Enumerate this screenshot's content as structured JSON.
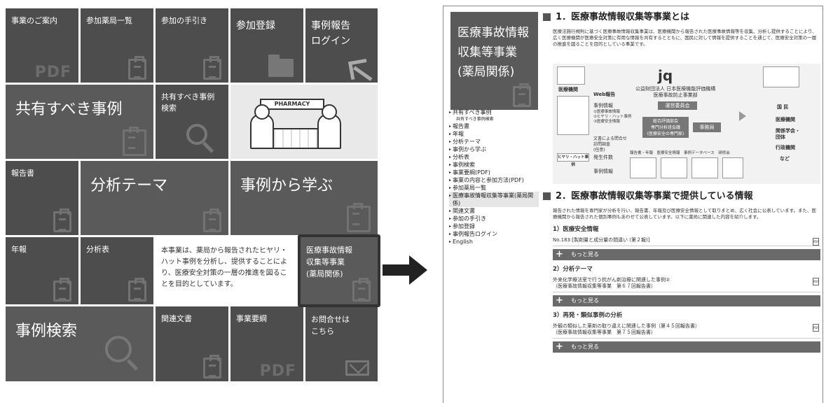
{
  "tiles": {
    "business_info": "事業のご案内",
    "pharmacies": "参加薬局一覧",
    "guide": "参加の手引き",
    "register": "参加登録",
    "report_login": "事例報告\nログイン",
    "shared_cases": "共有すべき事例",
    "shared_search": "共有すべき事例\n検索",
    "pharmacy_sign": "PHARMACY",
    "reports": "報告書",
    "analysis_themes": "分析テーマ",
    "learn_from_cases": "事例から学ぶ",
    "annual": "年報",
    "analysis_table": "分析表",
    "description": "本事業は、薬局から報告されたヒヤリ・ハット事例を分析し、提供することにより、医療安全対策の一層の推進を図ることを目的としています。",
    "project_tile": "医療事故情報\n収集等事業\n(薬局関係)",
    "case_search": "事例検索",
    "related_docs": "関連文書",
    "outline": "事業要綱",
    "contact": "お問合せは\nこちら",
    "pdf_mark": "PDF"
  },
  "page": {
    "tile_title": "医療事故情報\n収集等事業\n(薬局関係)",
    "sidebar": [
      {
        "label": "共有すべき事例",
        "sub": "共有すべき事例検索"
      },
      {
        "label": "報告書"
      },
      {
        "label": "年報"
      },
      {
        "label": "分析テーマ"
      },
      {
        "label": "事例から学ぶ"
      },
      {
        "label": "分析表"
      },
      {
        "label": "事例検索"
      },
      {
        "label": "事業要綱(PDF)"
      },
      {
        "label": "事業の内容と参加方法(PDF)"
      },
      {
        "label": "参加薬局一覧"
      },
      {
        "label": "医療事故情報収集等事業(薬局関係)",
        "active": true
      },
      {
        "label": "関連文書"
      },
      {
        "label": "参加の手引き"
      },
      {
        "label": "参加登録"
      },
      {
        "label": "事例報告ログイン"
      },
      {
        "label": "English"
      }
    ],
    "section1_title": "1．医療事故情報収集等事業とは",
    "section1_text": "医療法施行規則に基づく医療事故情報収集事業は、医療機関から報告された医療事故情報等を収集、分析し提供することにより、広く医療機関が医療安全対策に有用な情報を共有するとともに、国民に対して情報を提供することを通じて、医療安全対策の一層の推進を図ることを目的としている事業です。",
    "diagram": {
      "org_name": "公益財団法人 日本医療機能評価機構\n医療事故防止事業部",
      "committee": "運営委員会",
      "expert": "総合評価部会\n専門分析班会議\n(医療安全の専門家)",
      "secretariat": "事務局",
      "hospital": "医療機関",
      "web_report": "Web報告",
      "report_info": "事例情報",
      "items": "①医療事故情報\n②ヒヤリ・ハット事例\n③医療安全情報",
      "inquiry": "文書による問合せ\n訪問調査\n(任意)",
      "hiyari": "ヒヤリ・ハット事例",
      "occurrences": "発生件数",
      "case_info": "事例情報",
      "outputs": "報告書・年報　医療安全情報　事例データベース　研修会",
      "public": "国 民",
      "med_org": "医療機関",
      "academia": "関係学会・\n団体",
      "admin": "行政機関",
      "etc": "など"
    },
    "section2_title": "2．医療事故情報収集等事業で提供している情報",
    "section2_text": "報告された情報を専門家が分析を行い、報告書、年報及び医療安全情報として取りまとめ、広く社会に公表しています。また、医療機関から報告された個別事例もあわせて公表しています。以下に薬局に関連した内容を紹介します。",
    "subsections": [
      {
        "title": "1）医療安全情報",
        "entry": "No.183:[製剤量と成分量の間違い (第２報)]",
        "more": "もっと見る"
      },
      {
        "title": "2）分析テーマ",
        "entry": "外来化学療法室で行う抗がん剤治療に関連した事例②\n（医療事故情報収集等事業　第６７回報告書）",
        "more": "もっと見る"
      },
      {
        "title": "3）再発・類似事例の分析",
        "entry": "外観の類似した薬剤の取り違えに関連した事例（第４５回報告書）\n（医療事故情報収集等事業　第７５回報告書）",
        "more": "もっと見る"
      }
    ]
  }
}
